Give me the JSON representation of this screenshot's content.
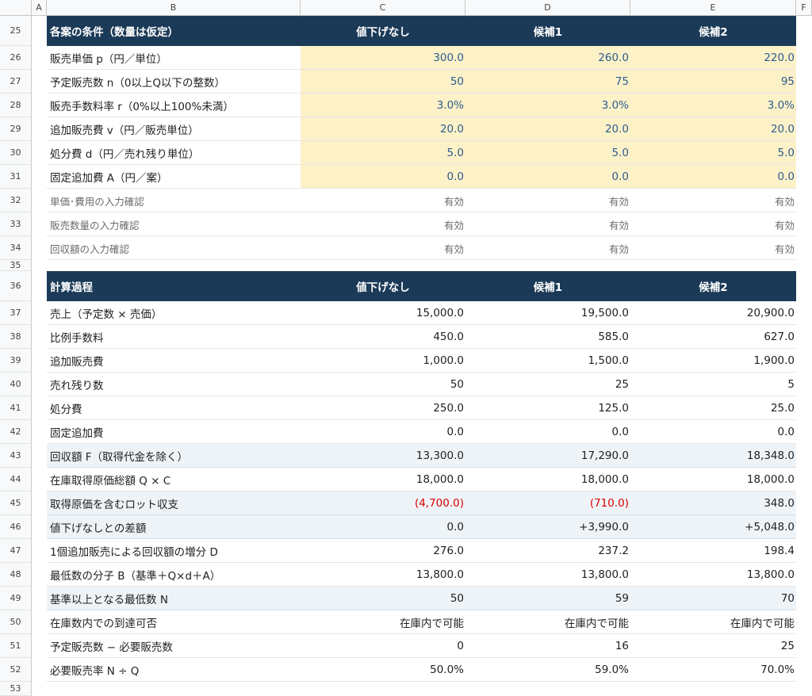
{
  "columns": [
    "A",
    "B",
    "C",
    "D",
    "E",
    "F"
  ],
  "rows": [
    {
      "num": "25",
      "type": "hdr",
      "label": "各案の条件（数量は仮定）",
      "c": "値下げなし",
      "d": "候補1",
      "e": "候補2"
    },
    {
      "num": "26",
      "type": "inp",
      "label": "販売単価 p（円／単位）",
      "c": "300.0",
      "d": "260.0",
      "e": "220.0"
    },
    {
      "num": "27",
      "type": "inp",
      "label": "予定販売数 n（0以上Q以下の整数）",
      "c": "50",
      "d": "75",
      "e": "95"
    },
    {
      "num": "28",
      "type": "inp",
      "label": "販売手数料率 r（0%以上100%未満）",
      "c": "3.0%",
      "d": "3.0%",
      "e": "3.0%"
    },
    {
      "num": "29",
      "type": "inp",
      "label": "追加販売費 v（円／販売単位）",
      "c": "20.0",
      "d": "20.0",
      "e": "20.0"
    },
    {
      "num": "30",
      "type": "inp",
      "label": "処分費 d（円／売れ残り単位）",
      "c": "5.0",
      "d": "5.0",
      "e": "5.0"
    },
    {
      "num": "31",
      "type": "inp",
      "label": "固定追加費 A（円／案）",
      "c": "0.0",
      "d": "0.0",
      "e": "0.0"
    },
    {
      "num": "32",
      "type": "chk",
      "label": "単価･費用の入力確認",
      "c": "有効",
      "d": "有効",
      "e": "有効"
    },
    {
      "num": "33",
      "type": "chk",
      "label": "販売数量の入力確認",
      "c": "有効",
      "d": "有効",
      "e": "有効"
    },
    {
      "num": "34",
      "type": "chk",
      "label": "回収額の入力確認",
      "c": "有効",
      "d": "有効",
      "e": "有効"
    },
    {
      "num": "35",
      "type": "blank",
      "label": "",
      "c": "",
      "d": "",
      "e": ""
    },
    {
      "num": "36",
      "type": "hdr",
      "label": "計算過程",
      "c": "値下げなし",
      "d": "候補1",
      "e": "候補2"
    },
    {
      "num": "37",
      "type": "n",
      "label": "売上（予定数 × 売価）",
      "c": "15,000.0",
      "d": "19,500.0",
      "e": "20,900.0"
    },
    {
      "num": "38",
      "type": "n",
      "label": "比例手数料",
      "c": "450.0",
      "d": "585.0",
      "e": "627.0"
    },
    {
      "num": "39",
      "type": "n",
      "label": "追加販売費",
      "c": "1,000.0",
      "d": "1,500.0",
      "e": "1,900.0"
    },
    {
      "num": "40",
      "type": "n",
      "label": "売れ残り数",
      "c": "50",
      "d": "25",
      "e": "5"
    },
    {
      "num": "41",
      "type": "n",
      "label": "処分費",
      "c": "250.0",
      "d": "125.0",
      "e": "25.0"
    },
    {
      "num": "42",
      "type": "n",
      "label": "固定追加費",
      "c": "0.0",
      "d": "0.0",
      "e": "0.0"
    },
    {
      "num": "43",
      "type": "hl",
      "label": "回収額 F（取得代金を除く）",
      "c": "13,300.0",
      "d": "17,290.0",
      "e": "18,348.0"
    },
    {
      "num": "44",
      "type": "n",
      "label": "在庫取得原価総額 Q × C",
      "c": "18,000.0",
      "d": "18,000.0",
      "e": "18,000.0"
    },
    {
      "num": "45",
      "type": "hl",
      "label": "取得原価を含むロット収支",
      "c": "(4,700.0)",
      "d": "(710.0)",
      "e": "348.0",
      "neg": [
        "c",
        "d"
      ]
    },
    {
      "num": "46",
      "type": "hl",
      "label": "値下げなしとの差額",
      "c": "0.0",
      "d": "+3,990.0",
      "e": "+5,048.0"
    },
    {
      "num": "47",
      "type": "n",
      "label": "1個追加販売による回収額の増分 D",
      "c": "276.0",
      "d": "237.2",
      "e": "198.4"
    },
    {
      "num": "48",
      "type": "n",
      "label": "最低数の分子 B（基準＋Q×d＋A）",
      "c": "13,800.0",
      "d": "13,800.0",
      "e": "13,800.0"
    },
    {
      "num": "49",
      "type": "hl",
      "label": "基準以上となる最低数 N",
      "c": "50",
      "d": "59",
      "e": "70"
    },
    {
      "num": "50",
      "type": "n",
      "label": "在庫数内での到達可否",
      "c": "在庫内で可能",
      "d": "在庫内で可能",
      "e": "在庫内で可能"
    },
    {
      "num": "51",
      "type": "n",
      "label": "予定販売数 − 必要販売数",
      "c": "0",
      "d": "16",
      "e": "25"
    },
    {
      "num": "52",
      "type": "n",
      "label": "必要販売率 N ÷ Q",
      "c": "50.0%",
      "d": "59.0%",
      "e": "70.0%"
    },
    {
      "num": "53",
      "type": "blank",
      "label": "",
      "c": "",
      "d": "",
      "e": ""
    }
  ]
}
